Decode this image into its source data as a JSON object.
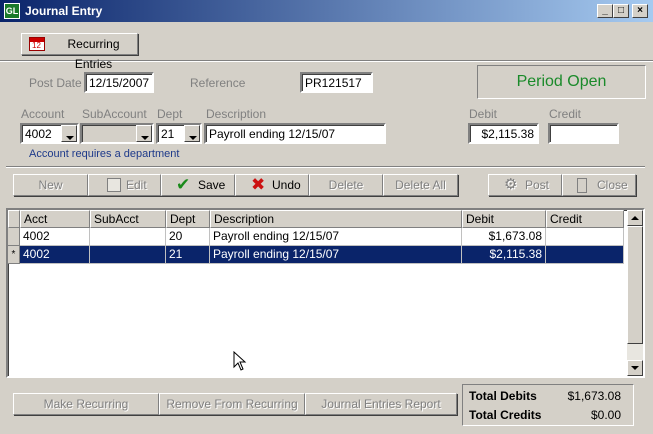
{
  "window": {
    "title": "Journal Entry",
    "app_icon": "GL"
  },
  "toolbar": {
    "recurring_label": "Recurring Entries"
  },
  "header": {
    "post_date_label": "Post Date",
    "post_date_value": "12/15/2007",
    "reference_label": "Reference",
    "reference_value": "PR121517",
    "status": "Period Open",
    "status_color": "#1a8a2a"
  },
  "entry": {
    "account_label": "Account",
    "account_value": "4002",
    "subaccount_label": "SubAccount",
    "subaccount_value": "",
    "dept_label": "Dept",
    "dept_value": "21",
    "description_label": "Description",
    "description_value": "Payroll ending 12/15/07",
    "debit_label": "Debit",
    "debit_value": "$2,115.38",
    "credit_label": "Credit",
    "credit_value": "",
    "warning": "Account requires a department"
  },
  "actions": {
    "new": "New",
    "edit": "Edit",
    "save": "Save",
    "undo": "Undo",
    "delete": "Delete",
    "delete_all": "Delete All",
    "post": "Post",
    "close": "Close"
  },
  "grid": {
    "columns": [
      "Acct",
      "SubAcct",
      "Dept",
      "Description",
      "Debit",
      "Credit"
    ],
    "rows": [
      {
        "indicator": "",
        "acct": "4002",
        "subacct": "",
        "dept": "20",
        "description": "Payroll ending 12/15/07",
        "debit": "$1,673.08",
        "credit": ""
      },
      {
        "indicator": "*",
        "acct": "4002",
        "subacct": "",
        "dept": "21",
        "description": "Payroll ending 12/15/07",
        "debit": "$2,115.38",
        "credit": ""
      }
    ]
  },
  "footer": {
    "make_recurring": "Make Recurring",
    "remove_recurring": "Remove From Recurring",
    "report": "Journal Entries Report",
    "total_debits_label": "Total Debits",
    "total_debits_value": "$1,673.08",
    "total_credits_label": "Total Credits",
    "total_credits_value": "$0.00"
  }
}
